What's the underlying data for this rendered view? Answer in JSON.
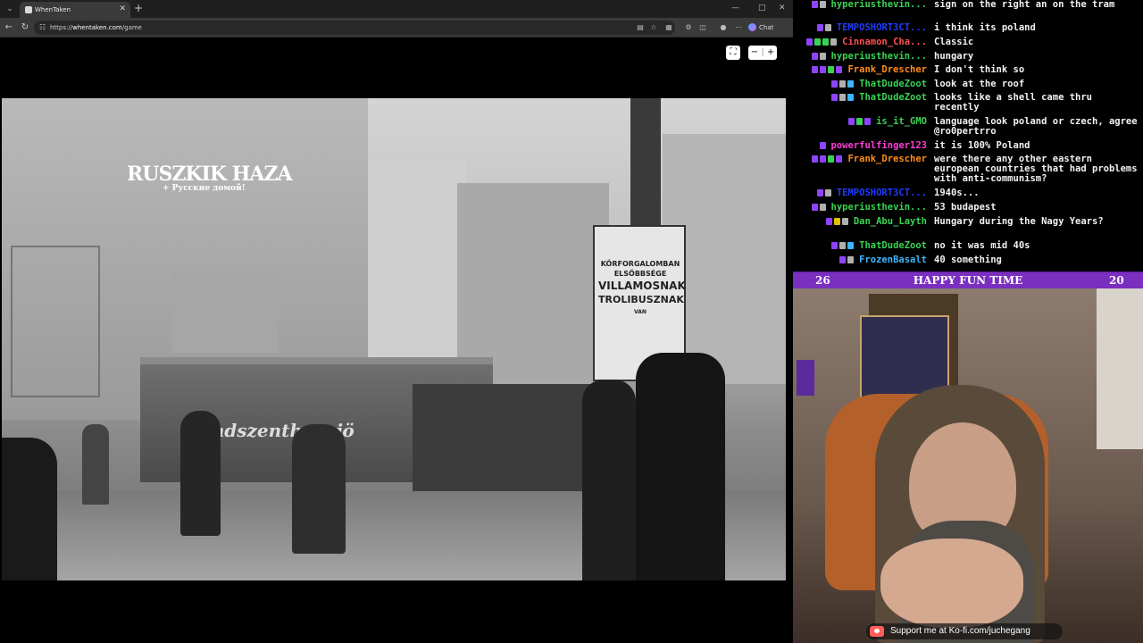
{
  "browser": {
    "tab": {
      "title": "WhenTaken"
    },
    "url": {
      "prefix": "https://",
      "host": "whentaken.com",
      "path": "/game"
    },
    "chat_chip_label": "Chat"
  },
  "photo": {
    "sign_main": "RUSZKIK HAZA",
    "sign_sub": "+ Русские домой!",
    "board_lines": [
      "KÖRFORGALOMBAN",
      "ELSŐBBSÉGE",
      "VILLAMOSNAK",
      "TROLIBUSZNAK",
      "VAN"
    ],
    "tram_graffiti": "Mindszenthy... jö"
  },
  "chat": {
    "colors": {
      "green": "#39d353",
      "blue": "#1e3cff",
      "red": "#ff4f4f",
      "orange": "#ff8c1a",
      "magenta": "#ff3dd6",
      "cyan": "#3db6ff",
      "white": "#f2f2f2"
    },
    "messages": [
      {
        "user": "hyperiusthevin...",
        "color": "#39d353",
        "text": "sign on the right an on the tram",
        "badges": [
          "#8e44ff",
          "#b0b0b0"
        ]
      },
      {
        "user": "TEMPOSHORT3CT...",
        "color": "#1e3cff",
        "text": "i think its poland",
        "badges": [
          "#8e44ff",
          "#b0b0b0"
        ]
      },
      {
        "user": "Cinnamon_Cha...",
        "color": "#ff4f4f",
        "text": "Classic",
        "badges": [
          "#8e44ff",
          "#39d353",
          "#39d353",
          "#b0b0b0"
        ]
      },
      {
        "user": "hyperiusthevin...",
        "color": "#39d353",
        "text": "hungary",
        "badges": [
          "#8e44ff",
          "#b0b0b0"
        ]
      },
      {
        "user": "Frank_Drescher",
        "color": "#ff8c1a",
        "text": "I don't think so",
        "badges": [
          "#8e44ff",
          "#8e44ff",
          "#39d353",
          "#8e44ff"
        ]
      },
      {
        "user": "ThatDudeZoot",
        "color": "#39d353",
        "text": "look at the roof",
        "badges": [
          "#8e44ff",
          "#b0b0b0",
          "#3db6ff"
        ]
      },
      {
        "user": "ThatDudeZoot",
        "color": "#39d353",
        "text": "looks like a shell came thru recently",
        "badges": [
          "#8e44ff",
          "#b0b0b0",
          "#3db6ff"
        ]
      },
      {
        "user": "is_it_GMO",
        "color": "#39d353",
        "text": "language look poland or czech, agree @ro0pertrro",
        "badges": [
          "#8e44ff",
          "#39d353",
          "#8e44ff"
        ]
      },
      {
        "user": "powerfulfinger123",
        "color": "#ff3dd6",
        "text": "it is 100% Poland",
        "badges": [
          "#8e44ff"
        ]
      },
      {
        "user": "Frank_Drescher",
        "color": "#ff8c1a",
        "text": "were there any other eastern european countries that had problems with anti-communism?",
        "badges": [
          "#8e44ff",
          "#8e44ff",
          "#39d353",
          "#8e44ff"
        ]
      },
      {
        "user": "TEMPOSHORT3CT...",
        "color": "#1e3cff",
        "text": "1940s...",
        "badges": [
          "#8e44ff",
          "#b0b0b0"
        ]
      },
      {
        "user": "hyperiusthevin...",
        "color": "#39d353",
        "text": "53 budapest",
        "badges": [
          "#8e44ff",
          "#b0b0b0"
        ]
      },
      {
        "user": "Dan_Abu_Layth",
        "color": "#39d353",
        "text": "Hungary during the Nagy Years?",
        "badges": [
          "#8e44ff",
          "#e0c000",
          "#b0b0b0"
        ]
      },
      {
        "user": "ThatDudeZoot",
        "color": "#39d353",
        "text": "no it was mid 40s",
        "badges": [
          "#8e44ff",
          "#b0b0b0",
          "#3db6ff"
        ]
      },
      {
        "user": "FrozenBasalt",
        "color": "#3db6ff",
        "text": "40 something",
        "badges": [
          "#8e44ff",
          "#b0b0b0"
        ]
      }
    ]
  },
  "banner": {
    "left": "26",
    "title": "HAPPY FUN TIME",
    "right": "20"
  },
  "kofi": {
    "text": "Support me at Ko-fi.com/juchegang"
  }
}
